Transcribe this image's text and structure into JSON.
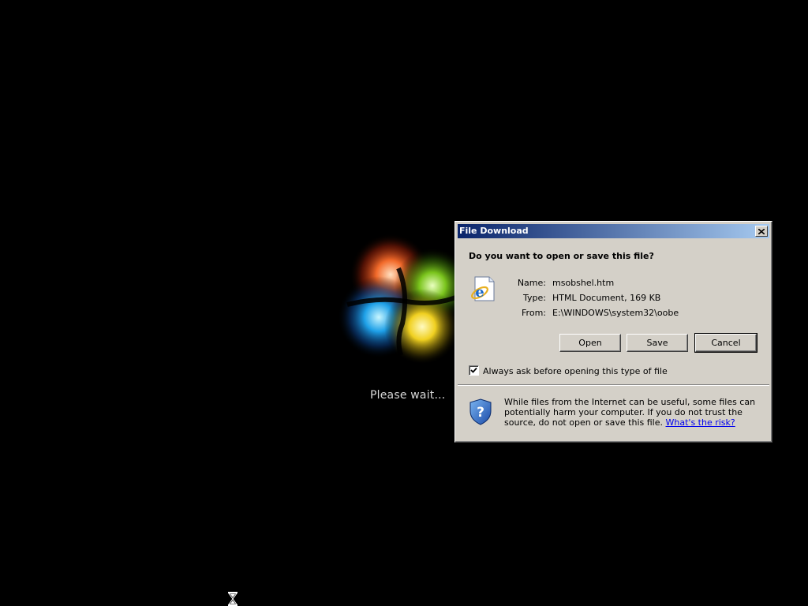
{
  "desktop": {
    "wait_text": "Please wait...",
    "logo_icon": "windows-logo-icon",
    "cursor_icon": "hourglass-icon"
  },
  "dialog": {
    "title": "File Download",
    "close_icon": "close-icon",
    "question": "Do you want to open or save this file?",
    "file_icon": "internet-explorer-document-icon",
    "info": {
      "name_label": "Name:",
      "name_value": "msobshel.htm",
      "type_label": "Type:",
      "type_value": "HTML Document, 169 KB",
      "from_label": "From:",
      "from_value": "E:\\WINDOWS\\system32\\oobe"
    },
    "buttons": {
      "open": "Open",
      "save": "Save",
      "cancel": "Cancel"
    },
    "checkbox": {
      "label": "Always ask before opening this type of file",
      "checked": true
    },
    "warning": {
      "icon": "shield-question-icon",
      "text": "While files from the Internet can be useful, some files can potentially harm your computer. If you do not trust the source, do not open or save this file.",
      "link": "What's the risk?"
    }
  },
  "colors": {
    "desktop_bg": "#000000",
    "dialog_bg": "#d4d0c8",
    "titlebar_start": "#0a246a",
    "titlebar_end": "#a6caf0",
    "link": "#0000ee"
  }
}
